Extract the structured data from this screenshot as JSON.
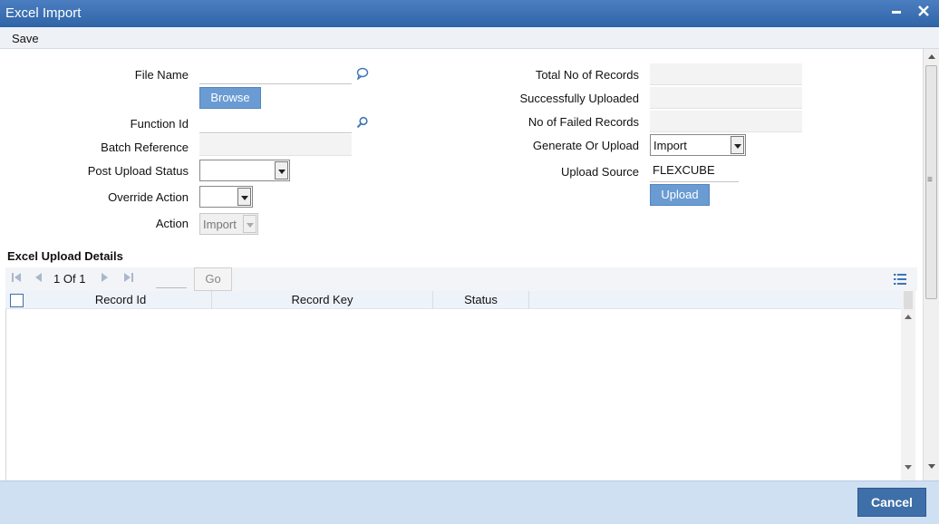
{
  "window": {
    "title": "Excel Import",
    "minimize_label": "▬",
    "close_label": "✕"
  },
  "menu": {
    "save_label": "Save"
  },
  "form": {
    "file_name_label": "File Name",
    "browse_label": "Browse",
    "function_id_label": "Function Id",
    "batch_reference_label": "Batch Reference",
    "post_upload_status_label": "Post Upload Status",
    "post_upload_status_value": "",
    "override_action_label": "Override Action",
    "override_action_value": "",
    "action_label": "Action",
    "action_value": "Import",
    "total_records_label": "Total No of Records",
    "successfully_uploaded_label": "Successfully Uploaded",
    "failed_records_label": "No of Failed Records",
    "generate_or_upload_label": "Generate Or Upload",
    "generate_or_upload_value": "Import",
    "upload_source_label": "Upload Source",
    "upload_source_value": "FLEXCUBE",
    "upload_label": "Upload"
  },
  "details": {
    "title": "Excel Upload Details",
    "pager": {
      "current": "1",
      "of_label": "Of",
      "total": "1",
      "go_label": "Go"
    },
    "columns": [
      "Record Id",
      "Record Key",
      "Status"
    ]
  },
  "footer": {
    "cancel_label": "Cancel"
  },
  "icons": {
    "file_name": "speech-bubble-icon",
    "function_id": "search-icon",
    "grid_settings": "list-settings-icon"
  },
  "colors": {
    "title_bar": "#2f64a6",
    "button": "#6a9bd3",
    "footer": "#cfe0f2"
  }
}
